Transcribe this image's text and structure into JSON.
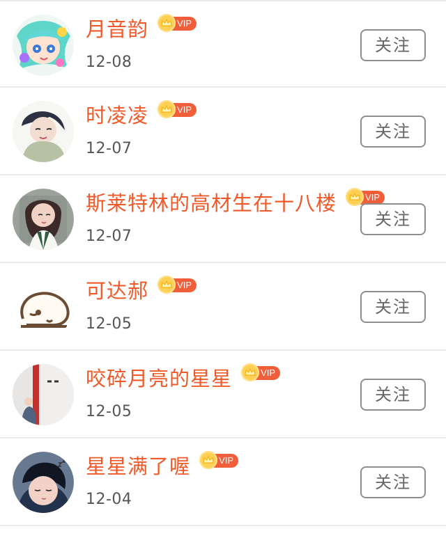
{
  "follow_list": {
    "items": [
      {
        "name": "月音韵",
        "vip_label": "VIP",
        "date": "12-08",
        "follow_label": "关注"
      },
      {
        "name": "时凌凌",
        "vip_label": "VIP",
        "date": "12-07",
        "follow_label": "关注"
      },
      {
        "name": "斯莱特林的高材生在十八楼",
        "vip_label": "VIP",
        "date": "12-07",
        "follow_label": "关注"
      },
      {
        "name": "可达郝",
        "vip_label": "VIP",
        "date": "12-05",
        "follow_label": "关注"
      },
      {
        "name": "咬碎月亮的星星",
        "vip_label": "VIP",
        "date": "12-05",
        "follow_label": "关注"
      },
      {
        "name": "星星满了喔",
        "vip_label": "VIP",
        "date": "12-04",
        "follow_label": "关注"
      }
    ]
  },
  "colors": {
    "name": "#f05a2a",
    "vip": "#f05f3a",
    "crown": "#ffd054",
    "date": "#555555",
    "button_border": "#8d8d8d",
    "divider": "#e9e9e9"
  },
  "icons": {
    "vip": "crown-icon"
  }
}
